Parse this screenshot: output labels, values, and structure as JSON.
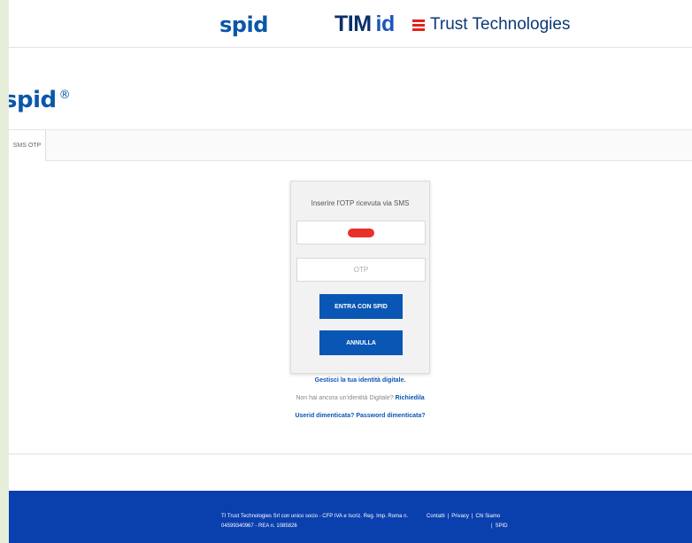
{
  "brand_header": {
    "spid_logo": "spid",
    "tim_logo": "TIM",
    "tim_logo_suffix": "id",
    "trust_logo": "Trust Technologies"
  },
  "main_logo": {
    "text": "spid",
    "mark": "®"
  },
  "tabs": [
    {
      "label": "SMS OTP",
      "active": true
    }
  ],
  "login_card": {
    "title": "Inserire l'OTP ricevuta via SMS",
    "otp_placeholder": "OTP",
    "otp_value": "",
    "enter_button": "ENTRA CON SPID",
    "cancel_button": "ANNULLA"
  },
  "links": {
    "manage_identity": "Gestisci la tua identità digitale.",
    "no_identity_text": "Non hai ancora un'identità Digitale?",
    "request_link": "Richiedila",
    "forgot_userid": "Userid dimenticata?",
    "forgot_password": "Password dimenticata?"
  },
  "footer": {
    "company_line1": "TI Trust Technologies Srl con unico socio - CFP IVA e Iscriz. Reg. Imp. Roma n.",
    "company_line2": "04599340967 - REA n. 1085826",
    "contacts": "Contatti",
    "privacy": "Privacy",
    "about": "Chi Siamo",
    "spid": "SPID",
    "separator": "|"
  },
  "colors": {
    "spid_blue": "#0a58a8",
    "button_blue": "#0a56b4",
    "footer_blue": "#0a3fae",
    "trust_red": "#e2231a",
    "masked_red": "#e8312a"
  }
}
